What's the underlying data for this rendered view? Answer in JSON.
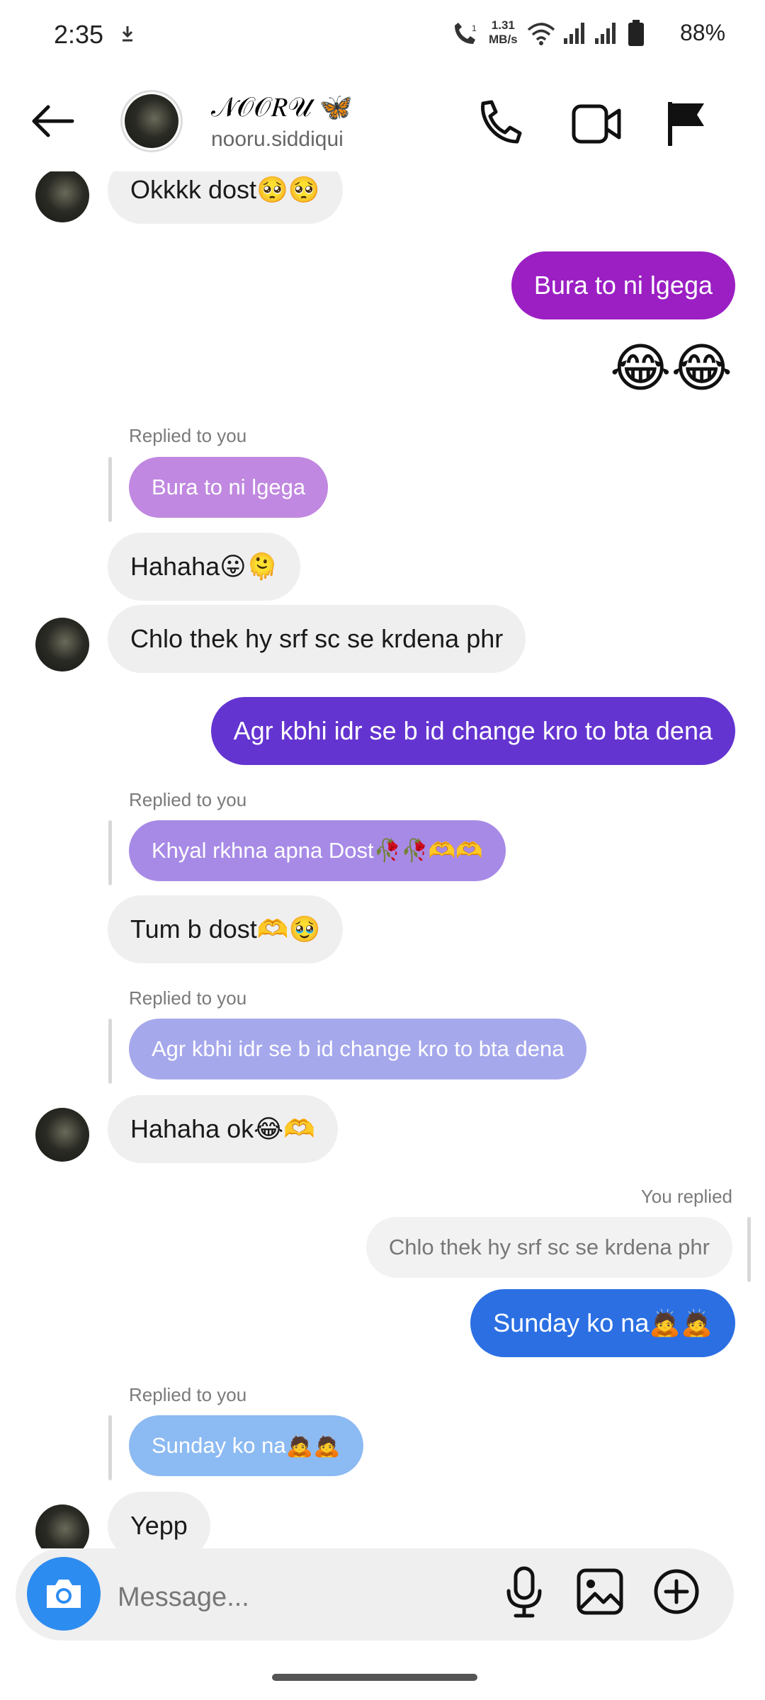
{
  "status_bar": {
    "time": "2:35",
    "download_icon": "download-arrow-icon",
    "net_speed_value": "1.31",
    "net_speed_unit": "MB/s",
    "battery": "88%"
  },
  "header": {
    "display_name": "𝒩𝒪𝒪𝑅𝒰 🦋",
    "username": "nooru.siddiqui",
    "icons": [
      "back-arrow-icon",
      "phone-icon",
      "video-icon",
      "flag-icon"
    ]
  },
  "messages": {
    "m1": "Okkkk dost🥺🥺",
    "m2": "Bura to ni lgega",
    "m3": "😂😂",
    "r1_label": "Replied to you",
    "r1_quote": "Bura to ni lgega",
    "m4": "Hahaha😛🫠",
    "m5": "Chlo thek hy srf sc se krdena phr",
    "m6": "Agr kbhi idr se b id change kro to bta dena",
    "r2_label": "Replied to you",
    "r2_quote": "Khyal rkhna apna Dost🥀🥀🫶🫶",
    "m7": "Tum b dost🫶🥹",
    "r3_label": "Replied to you",
    "r3_quote": "Agr kbhi idr se b id change kro to bta dena",
    "m8": "Hahaha ok😂🫶",
    "r4_label": "You replied",
    "r4_quote": "Chlo thek hy srf sc se krdena phr",
    "m9": "Sunday ko na🙇🙇",
    "r5_label": "Replied to you",
    "r5_quote": "Sunday ko na🙇🙇",
    "m10": "Yepp"
  },
  "composer": {
    "placeholder": "Message...",
    "icons": [
      "camera-icon",
      "microphone-icon",
      "gallery-icon",
      "add-icon"
    ]
  },
  "colors": {
    "incoming": "#efefef",
    "outgoing_purple": "#9b1fc3",
    "outgoing_indigo": "#6434d0",
    "outgoing_blue": "#2b6fe3",
    "camera_blue": "#2d8cf0"
  }
}
